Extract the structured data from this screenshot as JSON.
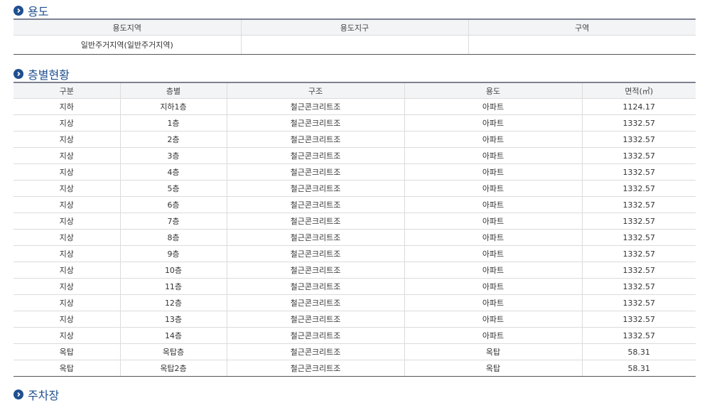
{
  "sections": {
    "use": {
      "title": "용도",
      "headers": [
        "용도지역",
        "용도지구",
        "구역"
      ],
      "row": [
        "일반주거지역(일반주거지역)",
        "",
        ""
      ]
    },
    "floors": {
      "title": "층별현황",
      "headers": [
        "구분",
        "층별",
        "구조",
        "용도",
        "면적(㎡)"
      ],
      "rows": [
        [
          "지하",
          "지하1층",
          "철근콘크리트조",
          "아파트",
          "1124.17"
        ],
        [
          "지상",
          "1층",
          "철근콘크리트조",
          "아파트",
          "1332.57"
        ],
        [
          "지상",
          "2층",
          "철근콘크리트조",
          "아파트",
          "1332.57"
        ],
        [
          "지상",
          "3층",
          "철근콘크리트조",
          "아파트",
          "1332.57"
        ],
        [
          "지상",
          "4층",
          "철근콘크리트조",
          "아파트",
          "1332.57"
        ],
        [
          "지상",
          "5층",
          "철근콘크리트조",
          "아파트",
          "1332.57"
        ],
        [
          "지상",
          "6층",
          "철근콘크리트조",
          "아파트",
          "1332.57"
        ],
        [
          "지상",
          "7층",
          "철근콘크리트조",
          "아파트",
          "1332.57"
        ],
        [
          "지상",
          "8층",
          "철근콘크리트조",
          "아파트",
          "1332.57"
        ],
        [
          "지상",
          "9층",
          "철근콘크리트조",
          "아파트",
          "1332.57"
        ],
        [
          "지상",
          "10층",
          "철근콘크리트조",
          "아파트",
          "1332.57"
        ],
        [
          "지상",
          "11층",
          "철근콘크리트조",
          "아파트",
          "1332.57"
        ],
        [
          "지상",
          "12층",
          "철근콘크리트조",
          "아파트",
          "1332.57"
        ],
        [
          "지상",
          "13층",
          "철근콘크리트조",
          "아파트",
          "1332.57"
        ],
        [
          "지상",
          "14층",
          "철근콘크리트조",
          "아파트",
          "1332.57"
        ],
        [
          "옥탑",
          "옥탑층",
          "철근콘크리트조",
          "옥탑",
          "58.31"
        ],
        [
          "옥탑",
          "옥탑2층",
          "철근콘크리트조",
          "옥탑",
          "58.31"
        ]
      ]
    },
    "parking": {
      "title": "주차장"
    }
  },
  "icons": {
    "section_bullet": "chevron-right-circle-icon"
  },
  "colors": {
    "accent": "#1f4f8f",
    "header_bg": "#f3f4f6",
    "border": "#7c8290"
  }
}
